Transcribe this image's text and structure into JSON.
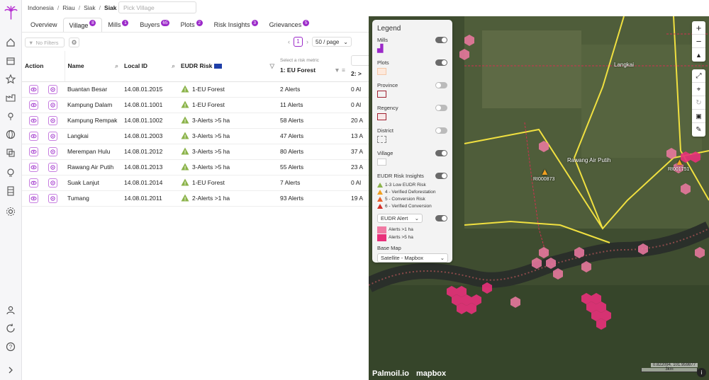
{
  "breadcrumb": [
    "Indonesia",
    "Riau",
    "Siak",
    "Siak"
  ],
  "village_picker": {
    "placeholder": "Pick Village"
  },
  "tabs": [
    {
      "label": "Overview",
      "count": ""
    },
    {
      "label": "Village",
      "count": "8"
    },
    {
      "label": "Mills",
      "count": "1"
    },
    {
      "label": "Buyers",
      "count": "65"
    },
    {
      "label": "Plots",
      "count": "2"
    },
    {
      "label": "Risk Insights",
      "count": "3"
    },
    {
      "label": "Grievances",
      "count": "5"
    }
  ],
  "toolbar": {
    "filters_label": "No Filters",
    "page": "1",
    "page_size": "50 / page"
  },
  "table": {
    "headers": {
      "action": "Action",
      "name": "Name",
      "local_id": "Local ID",
      "eudr_risk": "EUDR Risk",
      "metric_prompt": "Select a risk metric",
      "col1": "1: EU Forest",
      "col2": "2: >"
    },
    "rows": [
      {
        "name": "Buantan Besar",
        "local_id": "14.08.01.2015",
        "risk": "1-EU Forest",
        "risk_color": "#8bb34a",
        "c1": "2 Alerts",
        "c2": "0 Al"
      },
      {
        "name": "Kampung Dalam",
        "local_id": "14.08.01.1001",
        "risk": "1-EU Forest",
        "risk_color": "#8bb34a",
        "c1": "11 Alerts",
        "c2": "0 Al"
      },
      {
        "name": "Kampung Rempak",
        "local_id": "14.08.01.1002",
        "risk": "3-Alerts >5 ha",
        "risk_color": "#8bb34a",
        "c1": "58 Alerts",
        "c2": "20 A"
      },
      {
        "name": "Langkai",
        "local_id": "14.08.01.2003",
        "risk": "3-Alerts >5 ha",
        "risk_color": "#8bb34a",
        "c1": "47 Alerts",
        "c2": "13 A"
      },
      {
        "name": "Merempan Hulu",
        "local_id": "14.08.01.2012",
        "risk": "3-Alerts >5 ha",
        "risk_color": "#8bb34a",
        "c1": "80 Alerts",
        "c2": "37 A"
      },
      {
        "name": "Rawang Air Putih",
        "local_id": "14.08.01.2013",
        "risk": "3-Alerts >5 ha",
        "risk_color": "#8bb34a",
        "c1": "55 Alerts",
        "c2": "23 A"
      },
      {
        "name": "Suak Lanjut",
        "local_id": "14.08.01.2014",
        "risk": "1-EU Forest",
        "risk_color": "#8bb34a",
        "c1": "7 Alerts",
        "c2": "0 Al"
      },
      {
        "name": "Tumang",
        "local_id": "14.08.01.2011",
        "risk": "2-Alerts >1 ha",
        "risk_color": "#8bb34a",
        "c1": "93 Alerts",
        "c2": "19 A"
      }
    ]
  },
  "legend": {
    "title": "Legend",
    "layers": [
      {
        "label": "Mills",
        "on": true
      },
      {
        "label": "Plots",
        "on": true
      },
      {
        "label": "Province",
        "on": false
      },
      {
        "label": "Regency",
        "on": false
      },
      {
        "label": "District",
        "on": false
      },
      {
        "label": "Village",
        "on": true
      },
      {
        "label": "EUDR Risk Insights",
        "on": true
      }
    ],
    "risk_levels": [
      {
        "label": "1-3 Low EUDR Risk",
        "color": "#8bb34a"
      },
      {
        "label": "4 - Verified Deforestation",
        "color": "#f0a020"
      },
      {
        "label": "5 - Conversion Risk",
        "color": "#e8602a"
      },
      {
        "label": "6 - Verified Conversion",
        "color": "#d0302a"
      }
    ],
    "alert_select": "EUDR Alert",
    "alert_items": [
      {
        "label": "Alerts >1 ha",
        "color": "#f07aa3"
      },
      {
        "label": "Alerts >5 ha",
        "color": "#e8307a"
      }
    ],
    "base_map_label": "Base Map",
    "base_map_value": "Satellite - Mapbox"
  },
  "map": {
    "labels": {
      "langkai": "Langkai",
      "rawang": "Rawang Air Putih",
      "pin1": "RI000873",
      "pin2": "RI001751"
    },
    "brand": "Palmoil.io",
    "mapbox": "mapbox",
    "coords": "0.822094, 101.959877",
    "scale": "3km"
  },
  "colors": {
    "accent": "#9b29c9"
  }
}
